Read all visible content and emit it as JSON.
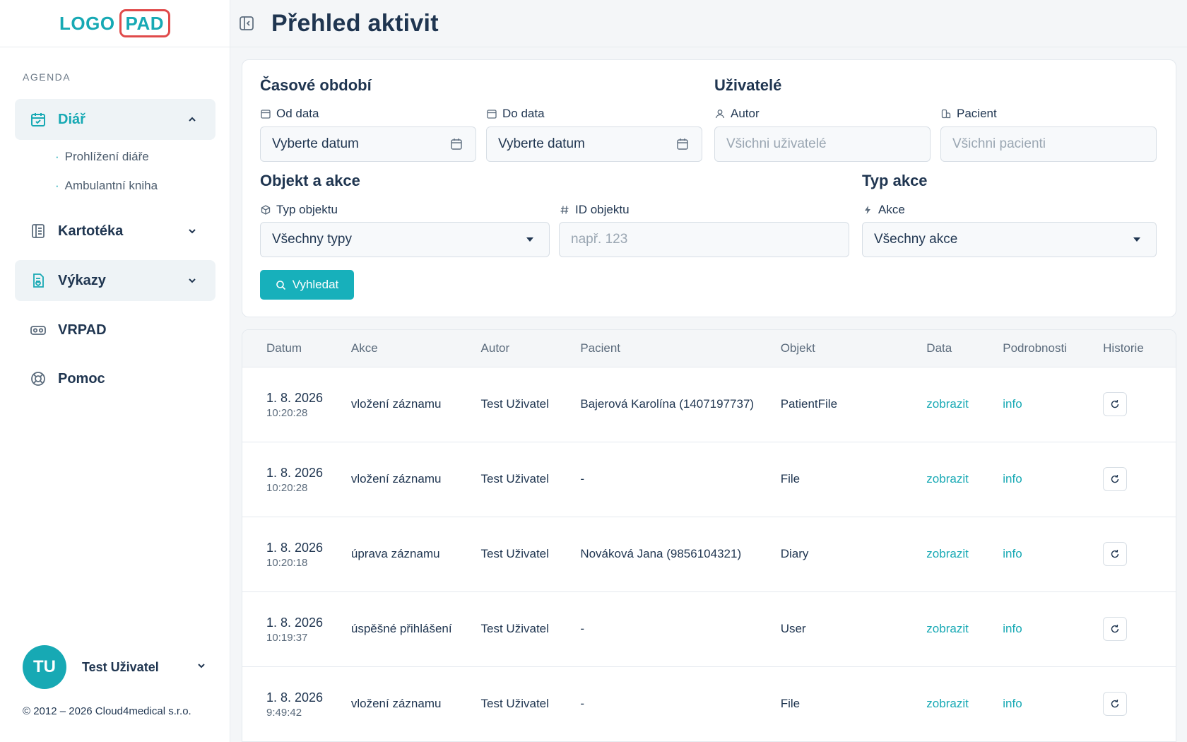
{
  "brand": {
    "logo_part1": "LOGO",
    "logo_part2": "PAD",
    "accent": "#17a9b4",
    "logo_border": "#e04a4a"
  },
  "sidebar": {
    "section_label": "AGENDA",
    "items": [
      {
        "label": "Diář",
        "icon": "calendar-check-icon",
        "expanded": true
      },
      {
        "label": "Kartotéka",
        "icon": "address-book-icon"
      },
      {
        "label": "Výkazy",
        "icon": "report-icon"
      },
      {
        "label": "VRPAD",
        "icon": "vr-headset-icon"
      },
      {
        "label": "Pomoc",
        "icon": "lifebuoy-icon"
      }
    ],
    "sub_items": [
      "Prohlížení diáře",
      "Ambulantní kniha"
    ],
    "user": {
      "initials": "TU",
      "name": "Test Uživatel"
    },
    "copyright": "© 2012 – 2026 Cloud4medical s.r.o."
  },
  "header": {
    "title": "Přehled aktivit"
  },
  "filters": {
    "period": {
      "title": "Časové období",
      "from_label": "Od data",
      "from_placeholder": "Vyberte datum",
      "to_label": "Do data",
      "to_placeholder": "Vyberte datum"
    },
    "users": {
      "title": "Uživatelé",
      "author_label": "Autor",
      "author_placeholder": "Všichni uživatelé",
      "patient_label": "Pacient",
      "patient_placeholder": "Všichni pacienti"
    },
    "object": {
      "title": "Objekt a akce",
      "type_label": "Typ objektu",
      "type_value": "Všechny typy",
      "id_label": "ID objektu",
      "id_placeholder": "např. 123"
    },
    "action": {
      "title": "Typ akce",
      "action_label": "Akce",
      "action_value": "Všechny akce"
    },
    "search_button": "Vyhledat"
  },
  "table": {
    "headers": [
      "Datum",
      "Akce",
      "Autor",
      "Pacient",
      "Objekt",
      "Data",
      "Podrobnosti",
      "Historie"
    ],
    "rows": [
      {
        "date": "1. 8. 2026",
        "time": "10:20:28",
        "action": "vložení záznamu",
        "author": "Test Uživatel",
        "patient": "Bajerová Karolína (1407197737)",
        "object": "PatientFile",
        "data_link": "zobrazit",
        "details_link": "info"
      },
      {
        "date": "1. 8. 2026",
        "time": "10:20:28",
        "action": "vložení záznamu",
        "author": "Test Uživatel",
        "patient": "-",
        "object": "File",
        "data_link": "zobrazit",
        "details_link": "info"
      },
      {
        "date": "1. 8. 2026",
        "time": "10:20:18",
        "action": "úprava záznamu",
        "author": "Test Uživatel",
        "patient": "Nováková Jana (9856104321)",
        "object": "Diary",
        "data_link": "zobrazit",
        "details_link": "info"
      },
      {
        "date": "1. 8. 2026",
        "time": "10:19:37",
        "action": "úspěšné přihlášení",
        "author": "Test Uživatel",
        "patient": "-",
        "object": "User",
        "data_link": "zobrazit",
        "details_link": "info"
      },
      {
        "date": "1. 8. 2026",
        "time": "9:49:42",
        "action": "vložení záznamu",
        "author": "Test Uživatel",
        "patient": "-",
        "object": "File",
        "data_link": "zobrazit",
        "details_link": "info"
      }
    ]
  }
}
